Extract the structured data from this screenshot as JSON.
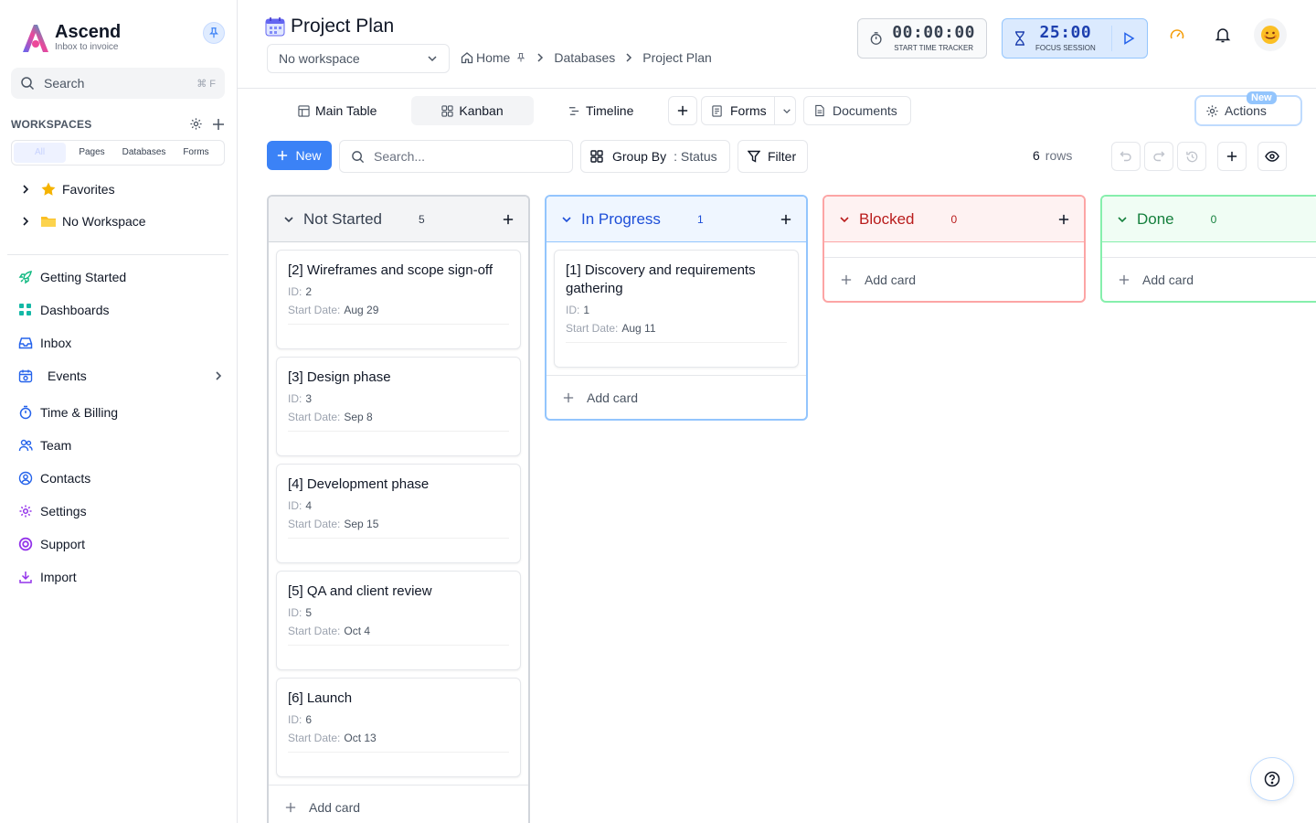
{
  "brand": {
    "name": "Ascend",
    "tagline": "Inbox to invoice"
  },
  "sidebar": {
    "search": {
      "label": "Search",
      "shortcut": "⌘ F"
    },
    "workspaces_label": "WORKSPACES",
    "filter_tabs": [
      "All",
      "Pages",
      "Databases",
      "Forms"
    ],
    "tree": [
      {
        "label": "Favorites",
        "icon": "star-icon"
      },
      {
        "label": "No Workspace",
        "icon": "folder-icon"
      }
    ],
    "nav": [
      {
        "label": "Getting Started",
        "icon": "rocket-icon"
      },
      {
        "label": "Dashboards",
        "icon": "grid-icon"
      },
      {
        "label": "Inbox",
        "icon": "inbox-icon"
      },
      {
        "label": "Events",
        "icon": "calendar-icon"
      },
      {
        "label": "Time & Billing",
        "icon": "stopwatch-icon"
      },
      {
        "label": "Team",
        "icon": "users-icon"
      },
      {
        "label": "Contacts",
        "icon": "contact-icon"
      },
      {
        "label": "Settings",
        "icon": "gear-icon"
      },
      {
        "label": "Support",
        "icon": "lifebuoy-icon"
      },
      {
        "label": "Import",
        "icon": "download-icon"
      }
    ]
  },
  "header": {
    "title": "Project Plan",
    "workspace_select": "No workspace",
    "breadcrumbs": [
      "Home",
      "Databases",
      "Project Plan"
    ],
    "time_tracker": {
      "value": "00:00:00",
      "caption": "START TIME TRACKER"
    },
    "focus_session": {
      "value": "25:00",
      "caption": "FOCUS SESSION"
    }
  },
  "tabs": {
    "main_table": "Main Table",
    "kanban": "Kanban",
    "timeline": "Timeline",
    "forms": "Forms",
    "documents": "Documents",
    "actions": "Actions",
    "new_badge": "New"
  },
  "toolbar": {
    "new_label": "New",
    "search_placeholder": "Search...",
    "group_by_label": "Group By",
    "group_by_value": ": Status",
    "filter_label": "Filter",
    "row_count": "6",
    "row_unit": "rows"
  },
  "board": {
    "id_label": "ID:",
    "start_label": "Start Date:",
    "add_card": "Add card",
    "columns": [
      {
        "title": "Not Started",
        "count": "5",
        "color": "#374151",
        "cards": [
          {
            "title": "[2] Wireframes and scope sign-off",
            "id": "2",
            "start": "Aug 29"
          },
          {
            "title": "[3] Design phase",
            "id": "3",
            "start": "Sep 8"
          },
          {
            "title": "[4] Development phase",
            "id": "4",
            "start": "Sep 15"
          },
          {
            "title": "[5] QA and client review",
            "id": "5",
            "start": "Oct 4"
          },
          {
            "title": "[6] Launch",
            "id": "6",
            "start": "Oct 13"
          }
        ]
      },
      {
        "title": "In Progress",
        "count": "1",
        "color": "#1d4ed8",
        "cards": [
          {
            "title": "[1] Discovery and requirements gathering",
            "id": "1",
            "start": "Aug 11"
          }
        ]
      },
      {
        "title": "Blocked",
        "count": "0",
        "color": "#b91c1c",
        "cards": []
      },
      {
        "title": "Done",
        "count": "0",
        "color": "#15803d",
        "cards": []
      }
    ]
  }
}
